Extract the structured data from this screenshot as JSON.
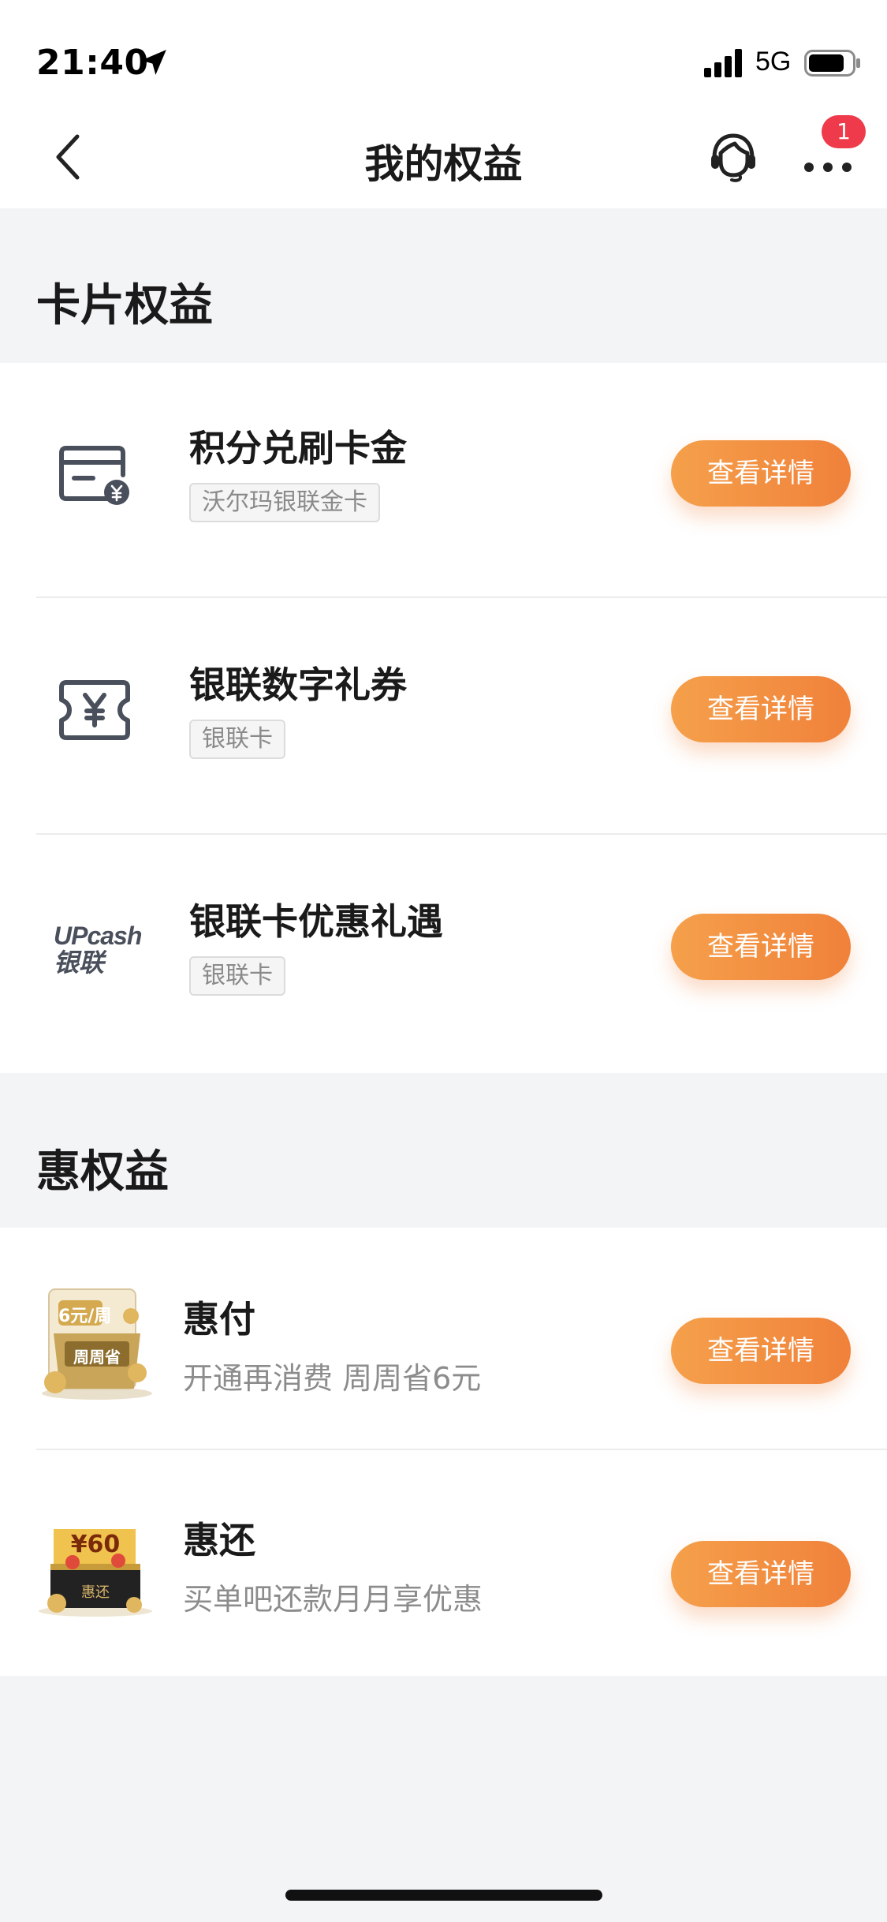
{
  "status_bar": {
    "time": "21:40",
    "network": "5G",
    "icons": [
      "location-arrow-icon",
      "signal-icon",
      "battery-icon"
    ]
  },
  "nav": {
    "title": "我的权益",
    "badge_count": "1",
    "icons": [
      "chevron-left-icon",
      "customer-service-icon",
      "more-icon"
    ]
  },
  "sections": [
    {
      "title": "卡片权益",
      "items": [
        {
          "title": "积分兑刷卡金",
          "tag": "沃尔玛银联金卡",
          "button": "查看详情",
          "icon": "card-yen-icon"
        },
        {
          "title": "银联数字礼券",
          "tag": "银联卡",
          "button": "查看详情",
          "icon": "ticket-yen-icon"
        },
        {
          "title": "银联卡优惠礼遇",
          "tag": "银联卡",
          "button": "查看详情",
          "icon": "upcash-logo-icon",
          "logo_text": [
            "UPcash",
            "银联"
          ]
        }
      ]
    },
    {
      "title": "惠权益",
      "items": [
        {
          "title": "惠付",
          "subtitle": "开通再消费 周周省6元",
          "button": "查看详情",
          "icon": "huifu-gift-icon",
          "logo_text": [
            "6元/周",
            "周周省"
          ]
        },
        {
          "title": "惠还",
          "subtitle": "买单吧还款月月享优惠",
          "button": "查看详情",
          "icon": "huihuan-gift-icon",
          "logo_text": [
            "¥60",
            "惠还"
          ]
        }
      ]
    }
  ],
  "colors": {
    "accent_start": "#f5a04b",
    "accent_end": "#f0813a",
    "badge": "#ee3a4a",
    "background": "#f3f4f6"
  }
}
